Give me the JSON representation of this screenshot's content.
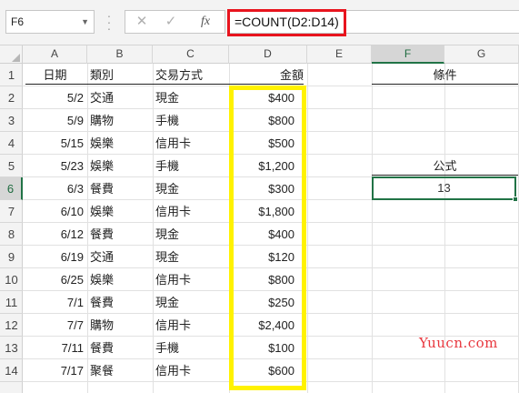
{
  "formula_bar": {
    "name_box": "F6",
    "cancel_glyph": "✕",
    "enter_glyph": "✓",
    "fx_label": "fx",
    "formula": "=COUNT(D2:D14)"
  },
  "columns": [
    "A",
    "B",
    "C",
    "D",
    "E",
    "F",
    "G"
  ],
  "active_column": "F",
  "rows": [
    "1",
    "2",
    "3",
    "4",
    "5",
    "6",
    "7",
    "8",
    "9",
    "10",
    "11",
    "12",
    "13",
    "14"
  ],
  "active_row": "6",
  "headers": {
    "date": "日期",
    "category": "類別",
    "payment": "交易方式",
    "amount": "金額",
    "condition": "條件"
  },
  "table": [
    {
      "date": "5/2",
      "category": "交通",
      "payment": "現金",
      "amount": "$400"
    },
    {
      "date": "5/9",
      "category": "購物",
      "payment": "手機",
      "amount": "$800"
    },
    {
      "date": "5/15",
      "category": "娛樂",
      "payment": "信用卡",
      "amount": "$500"
    },
    {
      "date": "5/23",
      "category": "娛樂",
      "payment": "手機",
      "amount": "$1,200"
    },
    {
      "date": "6/3",
      "category": "餐費",
      "payment": "現金",
      "amount": "$300"
    },
    {
      "date": "6/10",
      "category": "娛樂",
      "payment": "信用卡",
      "amount": "$1,800"
    },
    {
      "date": "6/12",
      "category": "餐費",
      "payment": "現金",
      "amount": "$400"
    },
    {
      "date": "6/19",
      "category": "交通",
      "payment": "現金",
      "amount": "$120"
    },
    {
      "date": "6/25",
      "category": "娛樂",
      "payment": "信用卡",
      "amount": "$800"
    },
    {
      "date": "7/1",
      "category": "餐費",
      "payment": "現金",
      "amount": "$250"
    },
    {
      "date": "7/7",
      "category": "購物",
      "payment": "信用卡",
      "amount": "$2,400"
    },
    {
      "date": "7/11",
      "category": "餐費",
      "payment": "手機",
      "amount": "$100"
    },
    {
      "date": "7/17",
      "category": "聚餐",
      "payment": "信用卡",
      "amount": "$600"
    }
  ],
  "formula_section": {
    "label": "公式",
    "result": "13"
  },
  "watermark": "Yuucn.com",
  "colors": {
    "formula_highlight": "#e8141e",
    "range_highlight": "#fff200",
    "selection": "#217346",
    "watermark": "#e8373e"
  }
}
